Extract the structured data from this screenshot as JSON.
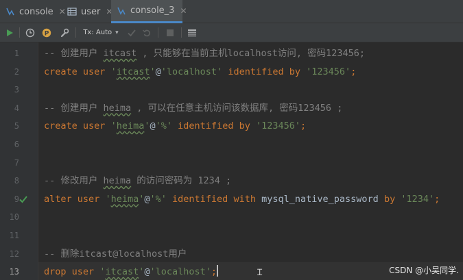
{
  "tabs": [
    {
      "label": "console",
      "icon": "console-icon",
      "active": false
    },
    {
      "label": "user",
      "icon": "table-icon",
      "active": false
    },
    {
      "label": "console_3",
      "icon": "console-icon",
      "active": true
    }
  ],
  "toolbar": {
    "tx_mode": "Tx: Auto"
  },
  "colors": {
    "keyword": "#cc7832",
    "string": "#6a8759",
    "comment": "#808080",
    "accent": "#4a88c7",
    "success": "#499c54"
  },
  "lines": [
    {
      "num": "1",
      "tokens": [
        {
          "t": "-- 创建用户 ",
          "c": "cmt"
        },
        {
          "t": "itcast",
          "c": "cmt wavy"
        },
        {
          "t": " , 只能够在当前主机localhost访问, 密码123456;",
          "c": "cmt"
        }
      ]
    },
    {
      "num": "2",
      "tokens": [
        {
          "t": "create",
          "c": "kw"
        },
        {
          "t": " ",
          "c": "plain"
        },
        {
          "t": "user",
          "c": "kw"
        },
        {
          "t": " ",
          "c": "plain"
        },
        {
          "t": "'",
          "c": "str"
        },
        {
          "t": "itcast",
          "c": "str wavy"
        },
        {
          "t": "'",
          "c": "str"
        },
        {
          "t": "@",
          "c": "plain"
        },
        {
          "t": "'localhost'",
          "c": "str"
        },
        {
          "t": " ",
          "c": "plain"
        },
        {
          "t": "identified",
          "c": "kw"
        },
        {
          "t": " ",
          "c": "plain"
        },
        {
          "t": "by",
          "c": "kw"
        },
        {
          "t": " ",
          "c": "plain"
        },
        {
          "t": "'123456'",
          "c": "str"
        },
        {
          "t": ";",
          "c": "kw"
        }
      ]
    },
    {
      "num": "3",
      "tokens": []
    },
    {
      "num": "4",
      "tokens": [
        {
          "t": "-- 创建用户 ",
          "c": "cmt"
        },
        {
          "t": "heima",
          "c": "cmt wavy"
        },
        {
          "t": " , 可以在任意主机访问该数据库, 密码123456 ;",
          "c": "cmt"
        }
      ]
    },
    {
      "num": "5",
      "tokens": [
        {
          "t": "create",
          "c": "kw"
        },
        {
          "t": " ",
          "c": "plain"
        },
        {
          "t": "user",
          "c": "kw"
        },
        {
          "t": " ",
          "c": "plain"
        },
        {
          "t": "'",
          "c": "str"
        },
        {
          "t": "heima",
          "c": "str wavy"
        },
        {
          "t": "'",
          "c": "str"
        },
        {
          "t": "@",
          "c": "plain"
        },
        {
          "t": "'%'",
          "c": "str"
        },
        {
          "t": " ",
          "c": "plain"
        },
        {
          "t": "identified",
          "c": "kw"
        },
        {
          "t": " ",
          "c": "plain"
        },
        {
          "t": "by",
          "c": "kw"
        },
        {
          "t": " ",
          "c": "plain"
        },
        {
          "t": "'123456'",
          "c": "str"
        },
        {
          "t": ";",
          "c": "kw"
        }
      ]
    },
    {
      "num": "6",
      "tokens": []
    },
    {
      "num": "7",
      "tokens": []
    },
    {
      "num": "8",
      "tokens": [
        {
          "t": "-- 修改用户 ",
          "c": "cmt"
        },
        {
          "t": "heima",
          "c": "cmt wavy"
        },
        {
          "t": " 的访问密码为 1234 ;",
          "c": "cmt"
        }
      ]
    },
    {
      "num": "9",
      "tokens": [
        {
          "t": "alter",
          "c": "kw"
        },
        {
          "t": " ",
          "c": "plain"
        },
        {
          "t": "user",
          "c": "kw"
        },
        {
          "t": " ",
          "c": "plain"
        },
        {
          "t": "'",
          "c": "str"
        },
        {
          "t": "heima",
          "c": "str wavy"
        },
        {
          "t": "'",
          "c": "str"
        },
        {
          "t": "@",
          "c": "plain"
        },
        {
          "t": "'%'",
          "c": "str"
        },
        {
          "t": " ",
          "c": "plain"
        },
        {
          "t": "identified",
          "c": "kw"
        },
        {
          "t": " ",
          "c": "plain"
        },
        {
          "t": "with",
          "c": "kw"
        },
        {
          "t": " ",
          "c": "plain"
        },
        {
          "t": "mysql_native_password",
          "c": "plain"
        },
        {
          "t": " ",
          "c": "plain"
        },
        {
          "t": "by",
          "c": "kw"
        },
        {
          "t": " ",
          "c": "plain"
        },
        {
          "t": "'1234'",
          "c": "str"
        },
        {
          "t": ";",
          "c": "kw"
        }
      ],
      "check": true
    },
    {
      "num": "10",
      "tokens": []
    },
    {
      "num": "11",
      "tokens": []
    },
    {
      "num": "12",
      "tokens": [
        {
          "t": "-- 删除itcast@localhost用户",
          "c": "cmt"
        }
      ]
    },
    {
      "num": "13",
      "tokens": [
        {
          "t": "drop",
          "c": "kw"
        },
        {
          "t": " ",
          "c": "plain"
        },
        {
          "t": "user",
          "c": "kw"
        },
        {
          "t": " ",
          "c": "plain"
        },
        {
          "t": "'",
          "c": "str"
        },
        {
          "t": "itcast",
          "c": "str wavy"
        },
        {
          "t": "'",
          "c": "str"
        },
        {
          "t": "@",
          "c": "plain"
        },
        {
          "t": "'localhost'",
          "c": "str"
        },
        {
          "t": ";",
          "c": "kw"
        }
      ],
      "current": true
    }
  ],
  "watermark": "CSDN @小吴同学."
}
